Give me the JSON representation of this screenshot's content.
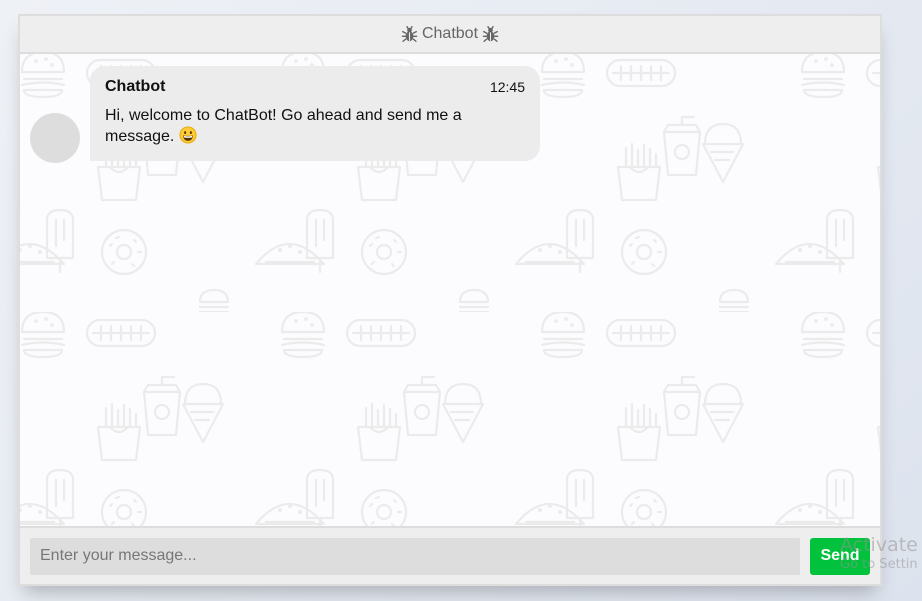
{
  "header": {
    "title": "Chatbot",
    "left_icon": "bug-icon",
    "right_icon": "bug-icon"
  },
  "messages": [
    {
      "sender": "Chatbot",
      "time": "12:45",
      "text": "Hi, welcome to ChatBot! Go ahead and send me a message.",
      "emoji": "grinning-face-icon"
    }
  ],
  "input": {
    "placeholder": "Enter your message...",
    "value": ""
  },
  "send_button": {
    "label": "Send"
  },
  "watermark": {
    "line1": "Activate W",
    "line2": "Go to Settin"
  },
  "colors": {
    "send_button": "#00c23c",
    "header_bg": "#eeeeee",
    "bubble_bg": "#ececec",
    "avatar": "#dddddd"
  },
  "background_pattern": [
    "burger-icon",
    "hotdog-icon",
    "drink-cup-icon",
    "fries-icon",
    "ice-cream-icon",
    "popsicle-icon",
    "taco-icon",
    "donut-icon"
  ]
}
